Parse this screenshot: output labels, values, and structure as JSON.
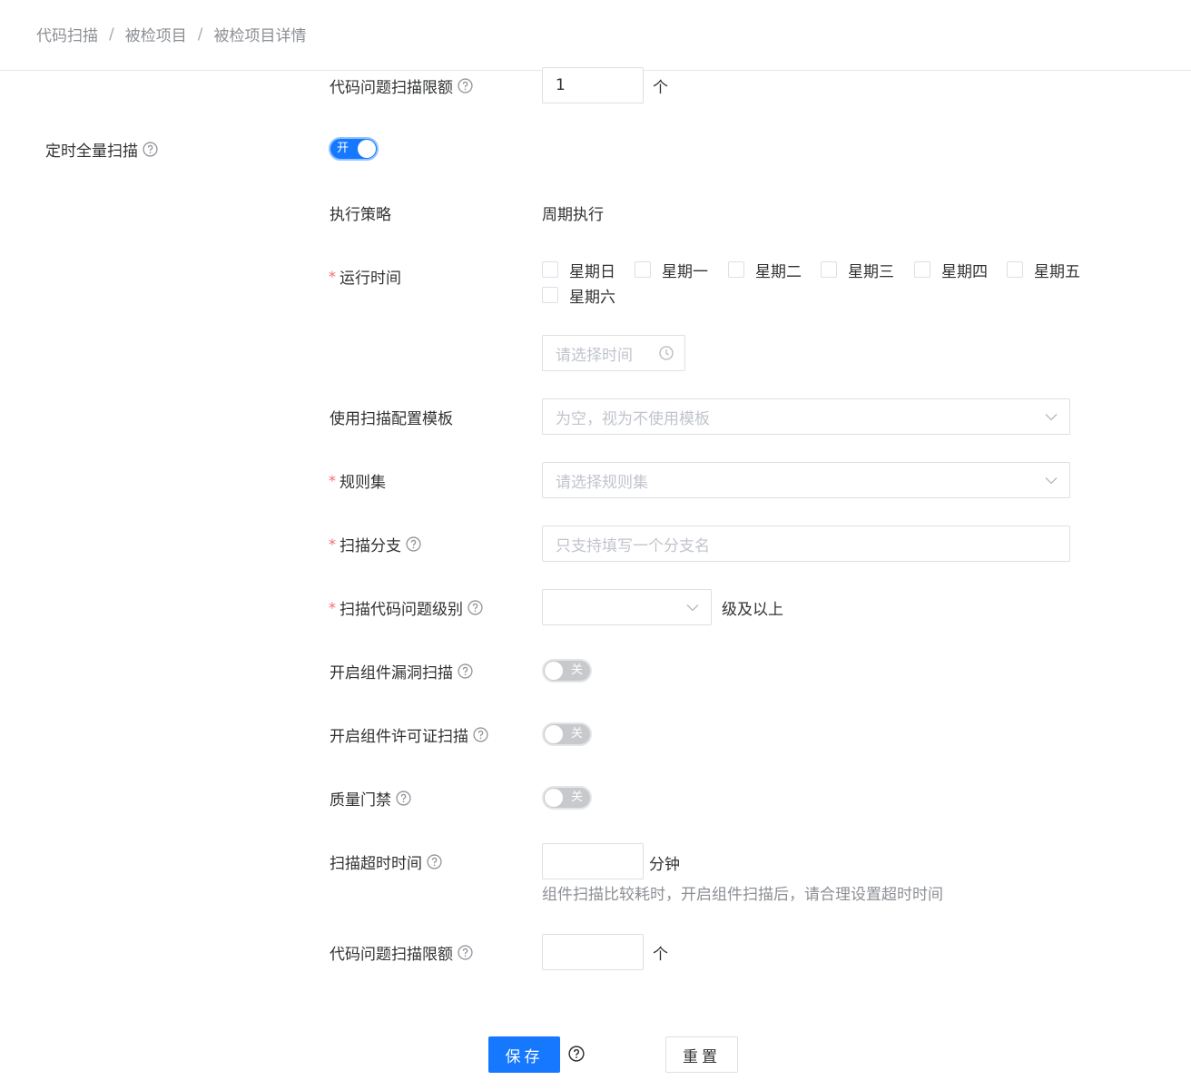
{
  "breadcrumb": [
    "代码扫描",
    "被检项目",
    "被检项目详情"
  ],
  "top_quota": {
    "label": "代码问题扫描限额",
    "value": "1",
    "unit": "个"
  },
  "scheduled_scan": {
    "label": "定时全量扫描",
    "switch_text": "开",
    "on": true
  },
  "strategy": {
    "label": "执行策略",
    "value": "周期执行"
  },
  "run_time": {
    "label": "运行时间",
    "days": [
      "星期日",
      "星期一",
      "星期二",
      "星期三",
      "星期四",
      "星期五",
      "星期六"
    ],
    "time_placeholder": "请选择时间"
  },
  "template": {
    "label": "使用扫描配置模板",
    "placeholder": "为空，视为不使用模板"
  },
  "ruleset": {
    "label": "规则集",
    "placeholder": "请选择规则集"
  },
  "branch": {
    "label": "扫描分支",
    "placeholder": "只支持填写一个分支名"
  },
  "issue_level": {
    "label": "扫描代码问题级别",
    "value": "",
    "suffix": "级及以上"
  },
  "vuln_scan": {
    "label": "开启组件漏洞扫描",
    "switch_text": "关",
    "on": false
  },
  "license_scan": {
    "label": "开启组件许可证扫描",
    "switch_text": "关",
    "on": false
  },
  "quality_gate": {
    "label": "质量门禁",
    "switch_text": "关",
    "on": false
  },
  "timeout": {
    "label": "扫描超时时间",
    "value": "",
    "unit": "分钟",
    "hint": "组件扫描比较耗时，开启组件扫描后，请合理设置超时时间"
  },
  "bottom_quota": {
    "label": "代码问题扫描限额",
    "value": "",
    "unit": "个"
  },
  "actions": {
    "save": "保存",
    "reset": "重置"
  }
}
